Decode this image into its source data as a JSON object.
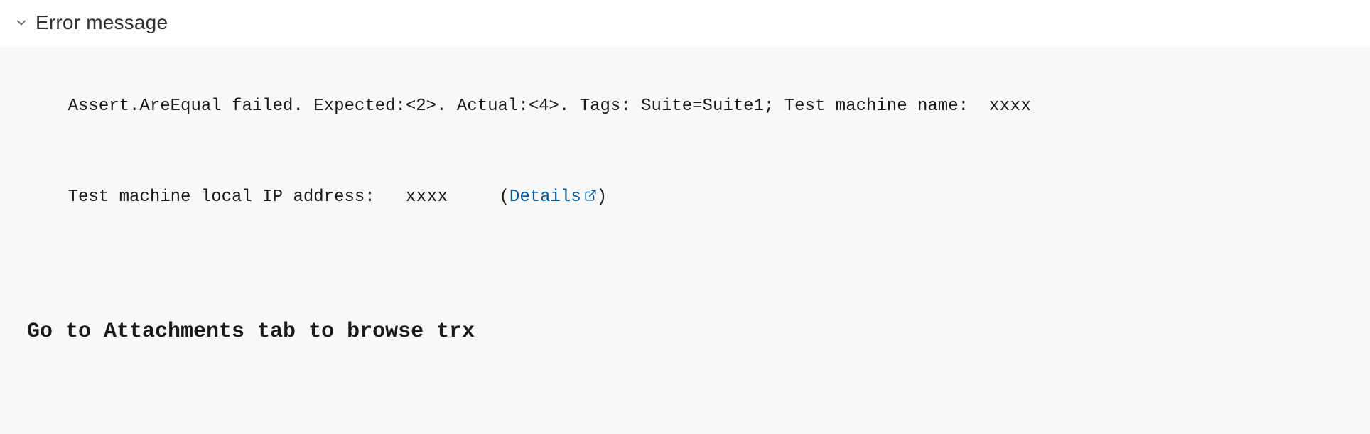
{
  "section": {
    "title": "Error message"
  },
  "error": {
    "line1_prefix": "Assert.AreEqual failed. Expected:<2>. Actual:<4>. Tags: Suite=Suite1; Test machine name:  ",
    "line1_redacted": "xxxx",
    "line2_prefix": "Test machine local IP address:   ",
    "line2_redacted": "xxxx",
    "details_label": "Details",
    "attachments_hint": "Go to Attachments tab to browse trx"
  }
}
